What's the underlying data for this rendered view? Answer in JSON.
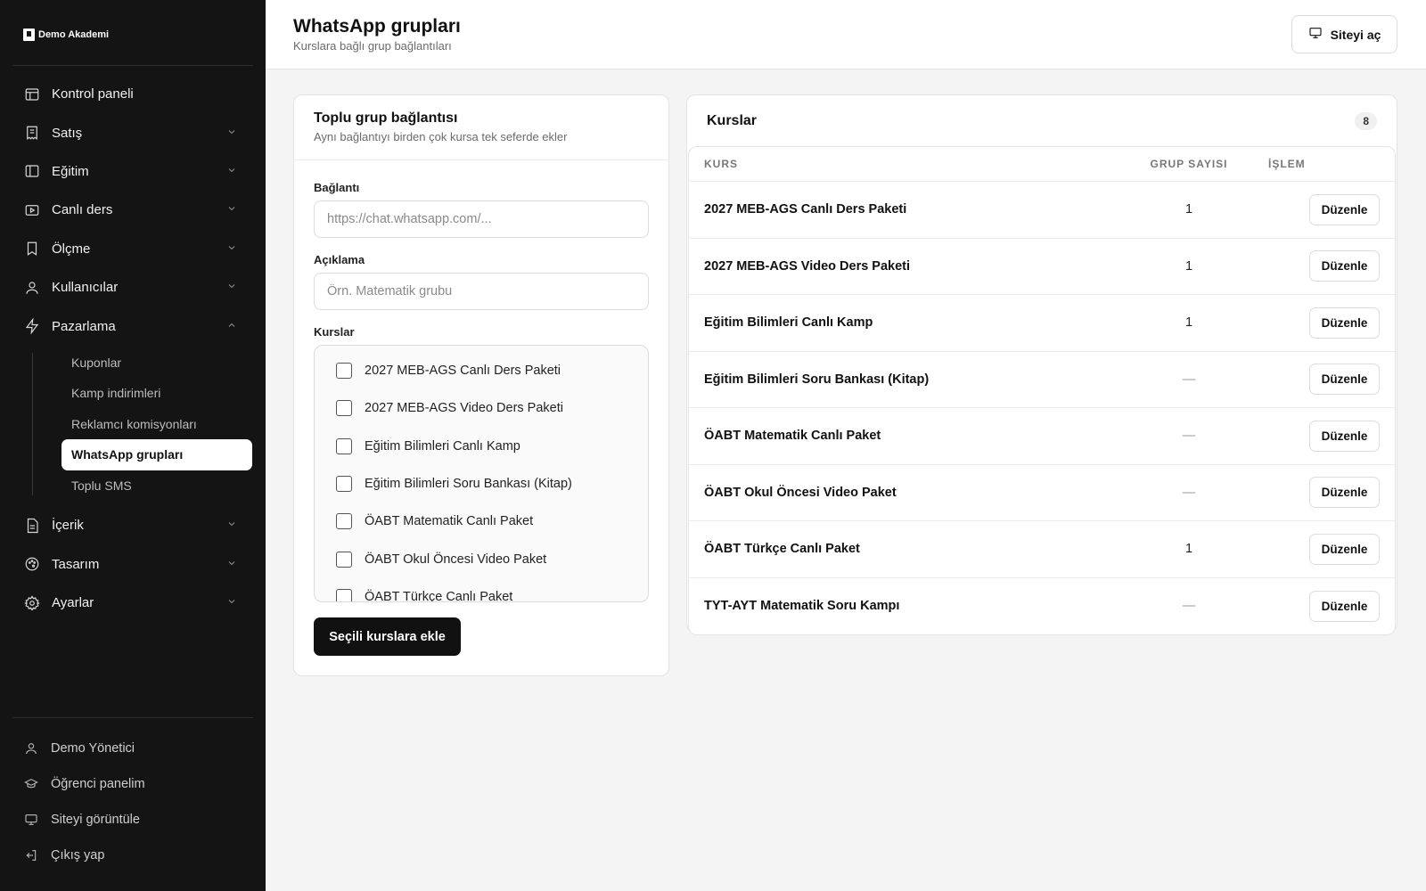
{
  "brand": {
    "name": "Demo Akademi"
  },
  "sidebar": {
    "items": [
      {
        "label": "Kontrol paneli",
        "icon": "layout-icon"
      },
      {
        "label": "Satış",
        "icon": "receipt-icon"
      },
      {
        "label": "Eğitim",
        "icon": "book-icon"
      },
      {
        "label": "Canlı ders",
        "icon": "video-icon"
      },
      {
        "label": "Ölçme",
        "icon": "bookmark-icon"
      },
      {
        "label": "Kullanıcılar",
        "icon": "user-icon"
      },
      {
        "label": "Pazarlama",
        "icon": "zap-icon"
      },
      {
        "label": "İçerik",
        "icon": "file-icon"
      },
      {
        "label": "Tasarım",
        "icon": "palette-icon"
      },
      {
        "label": "Ayarlar",
        "icon": "gear-icon"
      }
    ],
    "marketing_sub": [
      "Kuponlar",
      "Kamp indirimleri",
      "Reklamcı komisyonları",
      "WhatsApp grupları",
      "Toplu SMS"
    ],
    "bottom": [
      {
        "label": "Demo Yönetici",
        "icon": "user-icon"
      },
      {
        "label": "Öğrenci panelim",
        "icon": "graduation-cap-icon"
      },
      {
        "label": "Siteyi görüntüle",
        "icon": "monitor-icon"
      },
      {
        "label": "Çıkış yap",
        "icon": "logout-icon"
      }
    ]
  },
  "header": {
    "title": "WhatsApp grupları",
    "subtitle": "Kurslara bağlı grup bağlantıları",
    "open_site": "Siteyi aç"
  },
  "bulk": {
    "title": "Toplu grup bağlantısı",
    "subtitle": "Aynı bağlantıyı birden çok kursa tek seferde ekler",
    "link_label": "Bağlantı",
    "link_placeholder": "https://chat.whatsapp.com/...",
    "desc_label": "Açıklama",
    "desc_placeholder": "Örn. Matematik grubu",
    "courses_label": "Kurslar",
    "courses": [
      "2027 MEB-AGS Canlı Ders Paketi",
      "2027 MEB-AGS Video Ders Paketi",
      "Eğitim Bilimleri Canlı Kamp",
      "Eğitim Bilimleri Soru Bankası (Kitap)",
      "ÖABT Matematik Canlı Paket",
      "ÖABT Okul Öncesi Video Paket",
      "ÖABT Türkçe Canlı Paket"
    ],
    "submit": "Seçili kurslara ekle"
  },
  "courses": {
    "title": "Kurslar",
    "count": "8",
    "columns": [
      "KURS",
      "GRUP SAYISI",
      "İŞLEM"
    ],
    "edit_label": "Düzenle",
    "rows": [
      {
        "name": "2027 MEB-AGS Canlı Ders Paketi",
        "count": "1"
      },
      {
        "name": "2027 MEB-AGS Video Ders Paketi",
        "count": "1"
      },
      {
        "name": "Eğitim Bilimleri Canlı Kamp",
        "count": "1"
      },
      {
        "name": "Eğitim Bilimleri Soru Bankası (Kitap)",
        "count": "—"
      },
      {
        "name": "ÖABT Matematik Canlı Paket",
        "count": "—"
      },
      {
        "name": "ÖABT Okul Öncesi Video Paket",
        "count": "—"
      },
      {
        "name": "ÖABT Türkçe Canlı Paket",
        "count": "1"
      },
      {
        "name": "TYT-AYT Matematik Soru Kampı",
        "count": "—"
      }
    ]
  }
}
